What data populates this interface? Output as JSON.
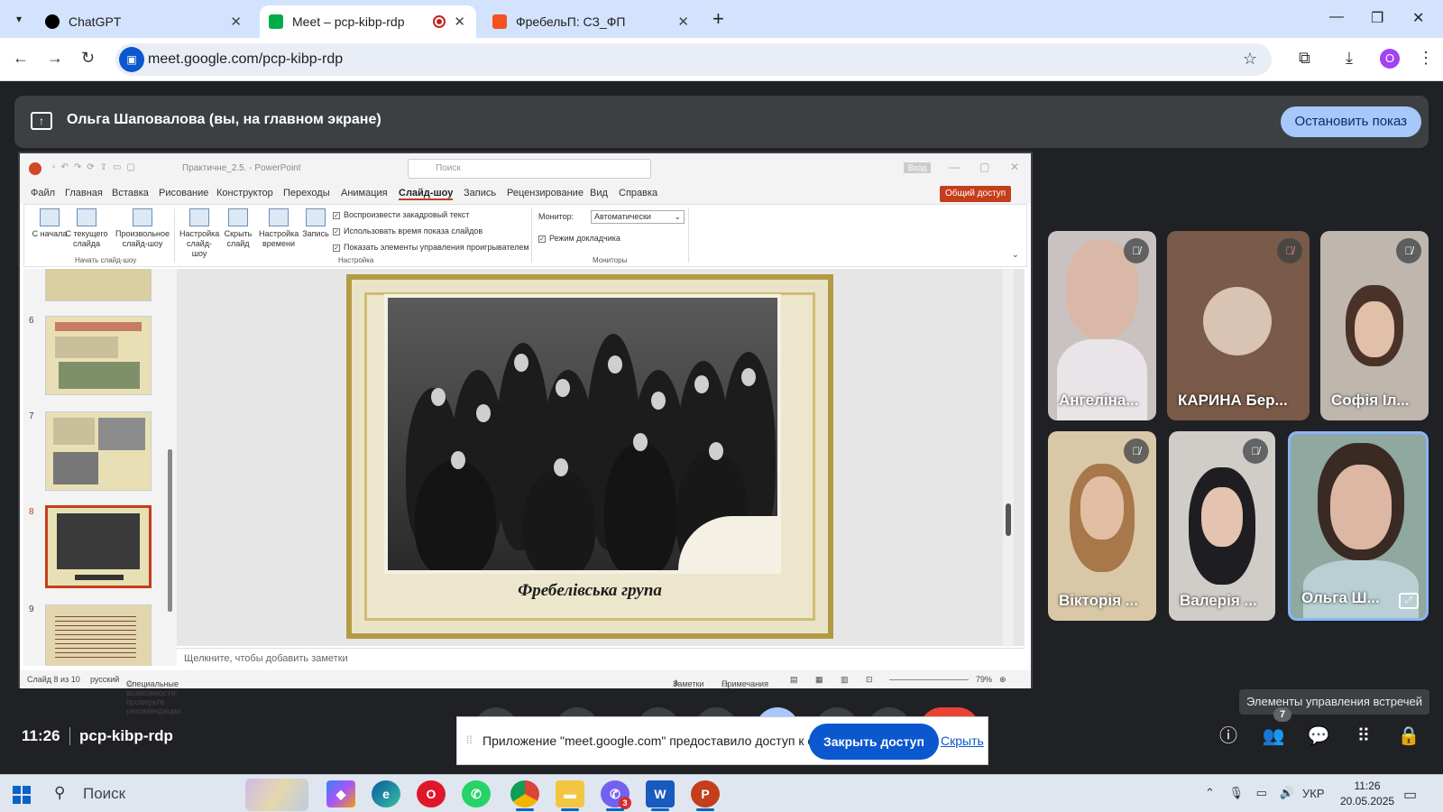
{
  "browser": {
    "tabs": [
      {
        "label": "ChatGPT",
        "favicon_color": "#000000"
      },
      {
        "label": "Meet – pcp-kibp-rdp",
        "favicon_color": "#00ac47",
        "recording": true
      },
      {
        "label": "ФребельП: СЗ_ФП",
        "favicon_color": "#f4511e"
      }
    ],
    "url": "meet.google.com/pcp-kibp-rdp",
    "profile_initial": "O"
  },
  "presenting": {
    "text": "Ольга Шаповалова (вы, на главном экране)",
    "stop_label": "Остановить показ"
  },
  "ppt": {
    "doc_name": "Практичне_2.5. - PowerPoint",
    "search_placeholder": "Поиск",
    "signin": "Вход",
    "menu": [
      "Файл",
      "Главная",
      "Вставка",
      "Рисование",
      "Конструктор",
      "Переходы",
      "Анимация",
      "Слайд-шоу",
      "Запись",
      "Рецензирование",
      "Вид",
      "Справка"
    ],
    "share_label": "Общий доступ",
    "ribbon": {
      "from_start": "С начала",
      "from_current": "С текущего слайда",
      "custom_show": "Произвольное слайд-шоу",
      "group_start": "Начать слайд-шоу",
      "setup_show": "Настройка слайд-шоу",
      "hide_slide": "Скрыть слайд",
      "rehearse": "Настройка времени",
      "record": "Запись",
      "check_narration": "Воспроизвести закадровый текст",
      "check_timings": "Использовать время показа слайдов",
      "check_controls": "Показать элементы управления проигрывателем",
      "group_setup": "Настройка",
      "monitor_label": "Монитор:",
      "monitor_value": "Автоматически",
      "presenter_view": "Режим докладчика",
      "group_monitors": "Мониторы"
    },
    "thumb_numbers": [
      "6",
      "7",
      "8",
      "9"
    ],
    "slide_caption": "Фребелівська група",
    "notes_placeholder": "Щелкните, чтобы добавить заметки",
    "status": {
      "slide_of": "Слайд 8 из 10",
      "language": "русский",
      "accessibility": "Специальные возможности: проверьте рекомендации",
      "notes": "Заметки",
      "comments": "Примечания",
      "zoom": "79%"
    }
  },
  "participants": [
    {
      "name": "Ангеліна...",
      "muted": true
    },
    {
      "name": "КАРИНА Бер...",
      "muted": true
    },
    {
      "name": "Софія Іл...",
      "muted": true
    },
    {
      "name": "Вікторія ...",
      "muted": true
    },
    {
      "name": "Валерія ...",
      "muted": true
    },
    {
      "name": "Ольга Ш...",
      "muted": false
    }
  ],
  "tooltip": "Элементы управления встречей",
  "meeting": {
    "time": "11:26",
    "code": "pcp-kibp-rdp",
    "participant_count": "7"
  },
  "share_notice": {
    "message": "Приложение \"meet.google.com\" предоставило доступ к окну.",
    "close_label": "Закрыть доступ",
    "hide_label": "Скрыть"
  },
  "taskbar": {
    "search": "Поиск",
    "lang": "УКР",
    "time": "11:26",
    "date": "20.05.2025",
    "viber_badge": "3"
  }
}
